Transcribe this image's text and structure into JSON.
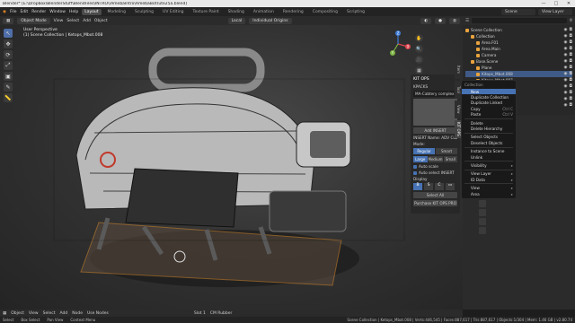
{
  "window": {
    "title": "Blender* [E:\\Dropbox\\BlenderStuff\\BlendFiles\\INTRO\\\\AmebaIntro\\AmebaBotTute25a.blend]",
    "controls": [
      "—",
      "□",
      "✕"
    ]
  },
  "menu": [
    "File",
    "Edit",
    "Render",
    "Window",
    "Help"
  ],
  "workspaces": [
    {
      "label": "Layout",
      "active": true
    },
    {
      "label": "Modeling",
      "active": false
    },
    {
      "label": "Sculpting",
      "active": false
    },
    {
      "label": "UV Editing",
      "active": false
    },
    {
      "label": "Texture Paint",
      "active": false
    },
    {
      "label": "Shading",
      "active": false
    },
    {
      "label": "Animation",
      "active": false
    },
    {
      "label": "Rendering",
      "active": false
    },
    {
      "label": "Compositing",
      "active": false
    },
    {
      "label": "Scripting",
      "active": false
    }
  ],
  "scene": {
    "label": "Scene",
    "view_layer": "View Layer"
  },
  "header": {
    "mode": "Object Mode",
    "items": [
      "View",
      "Select",
      "Add",
      "Object"
    ],
    "orientation": "Local",
    "pivot": "Individual Origins"
  },
  "viewport": {
    "view_name": "User Perspective",
    "collection_path": "(1) Scene Collection | Ketops_Mbot.008",
    "toolbar": [
      "↖",
      "✥",
      "⟳",
      "⤢",
      "▣",
      "✎",
      "📏"
    ],
    "nav": [
      "✋",
      "🔍",
      "🎥",
      "▦"
    ],
    "gizmo": {
      "x": "X",
      "y": "Y",
      "z": "Z"
    }
  },
  "n_panel_tabs": [
    "Item",
    "Tool",
    "View",
    "KIT OPS"
  ],
  "kit_ops": {
    "title": "KIT OPS",
    "kpack": "KPACKS",
    "kpack_value": "MA-Cabtery complex",
    "thumb_caption": "Add INSERT",
    "add_button": "Add INSERT",
    "insert_name": "INSERT Name: ADV Cube1 T",
    "mode_label": "Mode:",
    "mode_options": [
      "Regular",
      "Smart"
    ],
    "size_label": "Size",
    "size_options": [
      "Large",
      "Medium",
      "Small"
    ],
    "auto_scale": "Auto scale",
    "auto_select": "Auto select INSERT",
    "display_label": "Display",
    "display_options": [
      "B",
      "S",
      "C",
      "▭"
    ],
    "select_all": "Select All",
    "pro_button": "Purchase KIT OPS PRO"
  },
  "outliner": {
    "search": "",
    "rows": [
      {
        "label": "Scene Collection",
        "indent": 0,
        "selected": false
      },
      {
        "label": "Collection",
        "indent": 1,
        "selected": false
      },
      {
        "label": "Area.F01",
        "indent": 2,
        "selected": false
      },
      {
        "label": "Area.Main",
        "indent": 2,
        "selected": false
      },
      {
        "label": "Camera",
        "indent": 2,
        "selected": false
      },
      {
        "label": "Base.Scene",
        "indent": 1,
        "selected": false
      },
      {
        "label": "Plane",
        "indent": 2,
        "selected": false
      },
      {
        "label": "Kitops_Mbot.008",
        "indent": 2,
        "selected": true
      },
      {
        "label": "Kitops_Mbot.007",
        "indent": 2,
        "selected": false
      },
      {
        "label": "Kitops_Mbot.006",
        "indent": 2,
        "selected": false
      },
      {
        "label": "Kitops_Mbot.005",
        "indent": 2,
        "selected": false
      },
      {
        "label": "Kitops_Mbot.004",
        "indent": 2,
        "selected": false
      },
      {
        "label": "Kitops_Mbot.003",
        "indent": 2,
        "selected": false
      }
    ]
  },
  "context_menu": {
    "title": "Collection",
    "items": [
      {
        "label": "New",
        "shortcut": "",
        "highlight": true
      },
      {
        "label": "Duplicate Collection",
        "shortcut": "",
        "highlight": false
      },
      {
        "label": "Duplicate Linked",
        "shortcut": "",
        "highlight": false
      },
      {
        "label": "Copy",
        "shortcut": "Ctrl C",
        "highlight": false
      },
      {
        "label": "Paste",
        "shortcut": "Ctrl V",
        "highlight": false
      },
      {
        "sep": true
      },
      {
        "label": "Delete",
        "shortcut": "",
        "highlight": false
      },
      {
        "label": "Delete Hierarchy",
        "shortcut": "",
        "highlight": false
      },
      {
        "sep": true
      },
      {
        "label": "Select Objects",
        "shortcut": "",
        "highlight": false
      },
      {
        "label": "Deselect Objects",
        "shortcut": "",
        "highlight": false
      },
      {
        "sep": true
      },
      {
        "label": "Instance to Scene",
        "shortcut": "",
        "highlight": false
      },
      {
        "label": "Unlink",
        "shortcut": "",
        "highlight": false
      },
      {
        "sep": true
      },
      {
        "label": "Visibility",
        "shortcut": "▸",
        "highlight": false
      },
      {
        "sep": true
      },
      {
        "label": "View Layer",
        "shortcut": "▸",
        "highlight": false
      },
      {
        "label": "ID Data",
        "shortcut": "▸",
        "highlight": false
      },
      {
        "sep": true
      },
      {
        "label": "View",
        "shortcut": "▸",
        "highlight": false
      },
      {
        "label": "Area",
        "shortcut": "▸",
        "highlight": false
      }
    ]
  },
  "bottom": {
    "items": [
      "Object",
      "View",
      "Select",
      "Add",
      "Node"
    ],
    "use_nodes": "Use Nodes",
    "slot": "Slot 1",
    "material": "CM Rubber"
  },
  "status": {
    "left": [
      "Select",
      "Box Select",
      "Pan View",
      "Context Menu"
    ],
    "stats": "Scene Collection | Ketops_Mbot.008 | Verts:446,545 | Faces:887,617 | Tris:887,617 | Objects:1/304 | Mem: 1.46 GB | v2.80.74"
  }
}
